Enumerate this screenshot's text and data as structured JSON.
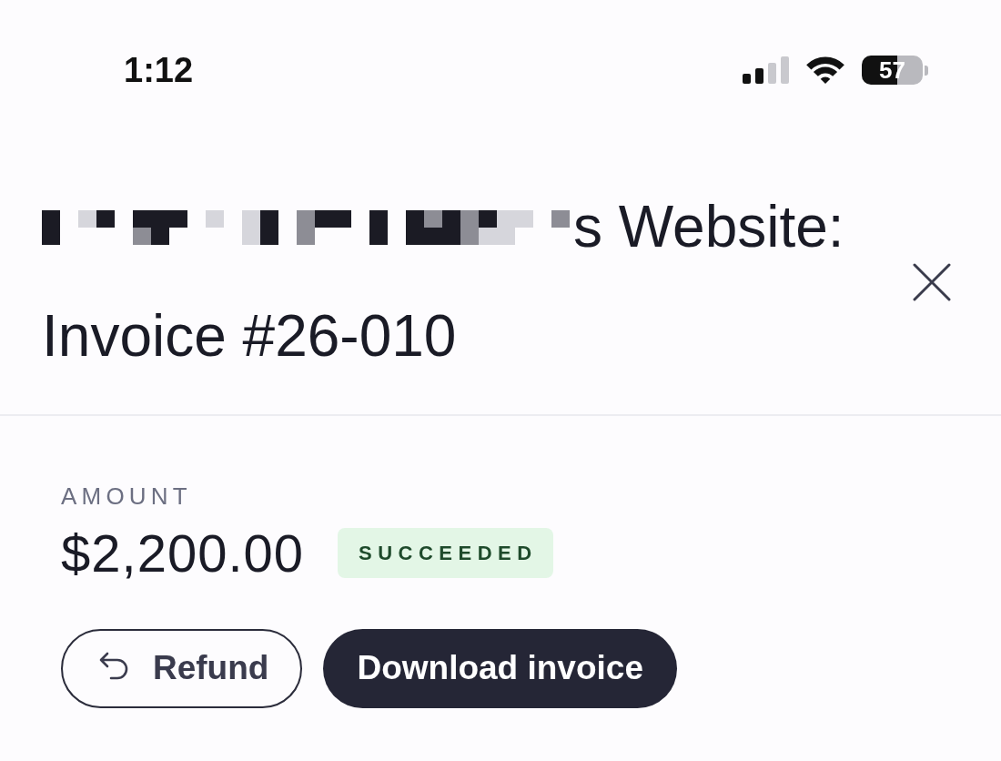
{
  "status_bar": {
    "time": "1:12",
    "battery": "57"
  },
  "header": {
    "title": {
      "redacted": true,
      "line_1_visible": "s Website:",
      "line_2": "Invoice #26-010"
    }
  },
  "amount": {
    "label": "AMOUNT",
    "value": "$2,200.00",
    "status": "SUCCEEDED"
  },
  "buttons": {
    "refund": "Refund",
    "download_invoice": "Download invoice"
  }
}
